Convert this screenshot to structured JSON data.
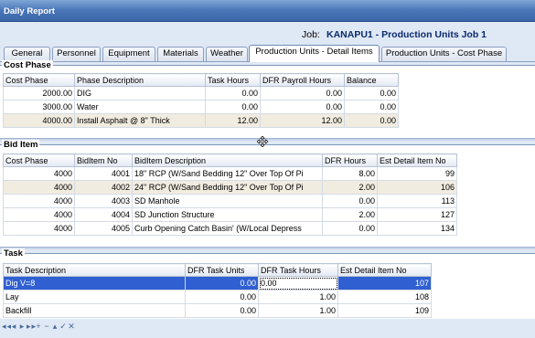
{
  "window": {
    "title": "Daily Report"
  },
  "header": {
    "job_label": "Job:",
    "job_value": "KANAPU1 - Production Units Job 1"
  },
  "tabs": [
    {
      "label": "General"
    },
    {
      "label": "Personnel"
    },
    {
      "label": "Equipment"
    },
    {
      "label": "Materials"
    },
    {
      "label": "Weather"
    },
    {
      "label": "Production Units - Detail Items",
      "active": true
    },
    {
      "label": "Production Units - Cost Phase"
    }
  ],
  "cost_phase": {
    "title": "Cost Phase",
    "columns": [
      "Cost Phase",
      "Phase Description",
      "Task Hours",
      "DFR Payroll Hours",
      "Balance"
    ],
    "rows": [
      [
        "2000.00",
        "DIG",
        "0.00",
        "0.00",
        "0.00"
      ],
      [
        "3000.00",
        "Water",
        "0.00",
        "0.00",
        "0.00"
      ],
      [
        "4000.00",
        "Install Asphalt @ 8\" Thick",
        "12.00",
        "12.00",
        "0.00"
      ]
    ]
  },
  "bid_item": {
    "title": "Bid Item",
    "columns": [
      "Cost Phase",
      "BidItem No",
      "BidItem Description",
      "DFR Hours",
      "Est Detail Item No"
    ],
    "rows": [
      [
        "4000",
        "4001",
        "18\" RCP (W/Sand Bedding 12\" Over Top Of Pi",
        "8.00",
        "99"
      ],
      [
        "4000",
        "4002",
        "24\" RCP (W/Sand Bedding 12\" Over Top Of Pi",
        "2.00",
        "106"
      ],
      [
        "4000",
        "4003",
        "SD Manhole",
        "0.00",
        "113"
      ],
      [
        "4000",
        "4004",
        "SD Junction Structure",
        "2.00",
        "127"
      ],
      [
        "4000",
        "4005",
        "Curb Opening Catch Basin' (W/Local Depress",
        "0.00",
        "134"
      ]
    ]
  },
  "task": {
    "title": "Task",
    "columns": [
      "Task Description",
      "DFR Task Units",
      "DFR Task Hours",
      "Est Detail Item No"
    ],
    "rows": [
      [
        "Dig V=8",
        "0.00",
        "0.00",
        "107"
      ],
      [
        "Lay",
        "0.00",
        "1.00",
        "108"
      ],
      [
        "Backfill",
        "0.00",
        "1.00",
        "109"
      ]
    ]
  },
  "navigator": {
    "glyphs": [
      "◂◂",
      "◂",
      "▸",
      "▸▸",
      "+",
      "−",
      "▴",
      "✓",
      "✕"
    ]
  },
  "colors": {
    "selection": "#2f5fd0",
    "alt_row": "#f1ece0",
    "title_bar": "#4a76b8"
  }
}
